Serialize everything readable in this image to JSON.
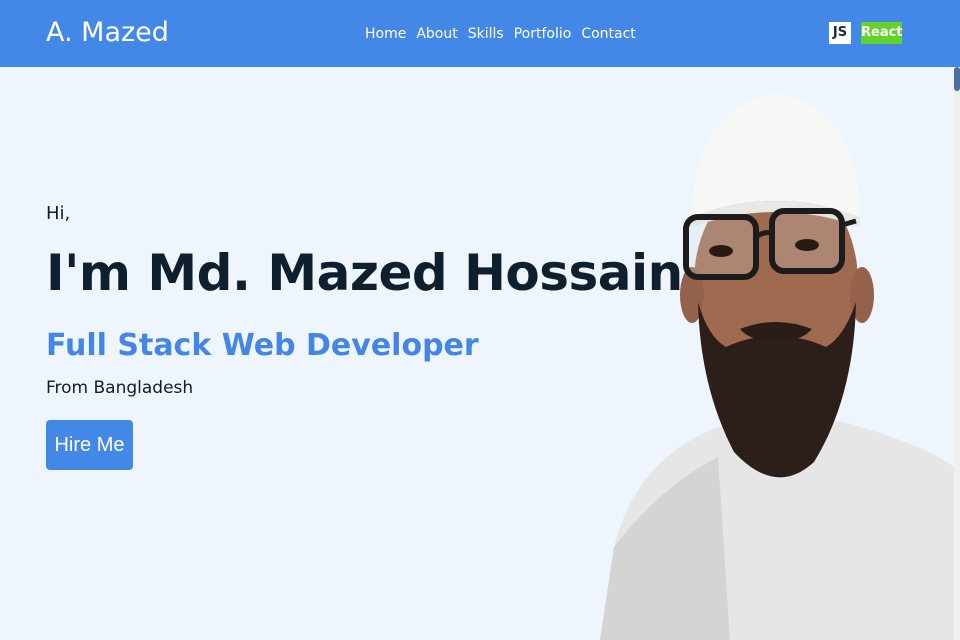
{
  "header": {
    "brand": "A. Mazed",
    "nav": [
      "Home",
      "About",
      "Skills",
      "Portfolio",
      "Contact"
    ],
    "badges": {
      "js": "JS",
      "react": "React"
    }
  },
  "hero": {
    "greeting": "Hi,",
    "name": "I'm Md. Mazed Hossain",
    "role": "Full Stack Web Developer",
    "origin": "From Bangladesh",
    "cta": "Hire Me"
  },
  "colors": {
    "navbar": "#4388e7",
    "background": "#eef5fd",
    "accent": "#4486e6",
    "react_badge": "#63d12e"
  },
  "portrait": {
    "icon": "profile-photo"
  }
}
